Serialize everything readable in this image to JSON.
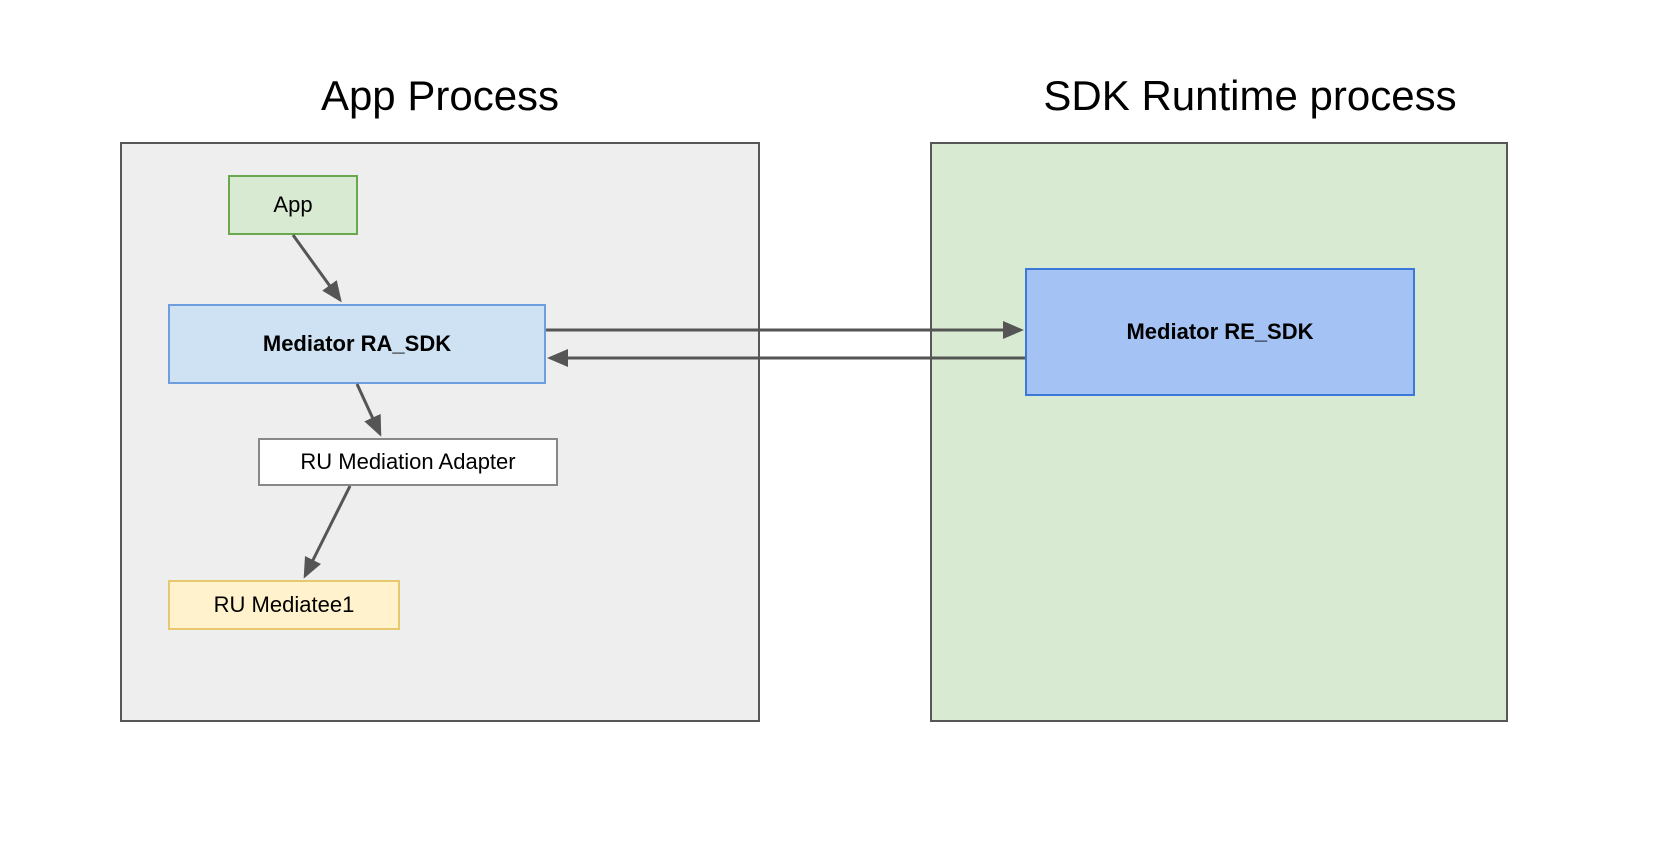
{
  "titles": {
    "app_process": "App Process",
    "sdk_runtime_process": "SDK Runtime process"
  },
  "nodes": {
    "app": "App",
    "mediator_ra_sdk": "Mediator RA_SDK",
    "ru_mediation_adapter": "RU Mediation Adapter",
    "ru_mediatee1": "RU Mediatee1",
    "mediator_re_sdk": "Mediator RE_SDK"
  },
  "colors": {
    "container_border": "#575757",
    "app_process_bg": "#eeeeee",
    "sdk_process_bg": "#d9ead3",
    "app_node_bg": "#d9ead3",
    "app_node_border": "#6aa84f",
    "ra_sdk_bg": "#cfe2f3",
    "ra_sdk_border": "#6e9de0",
    "adapter_bg": "#ffffff",
    "adapter_border": "#888888",
    "mediatee_bg": "#fff2cc",
    "mediatee_border": "#e6c96e",
    "re_sdk_bg": "#a4c2f4",
    "re_sdk_border": "#3c78d8",
    "arrow": "#555555"
  },
  "edges": [
    {
      "from": "app",
      "to": "mediator_ra_sdk",
      "direction": "down"
    },
    {
      "from": "mediator_ra_sdk",
      "to": "ru_mediation_adapter",
      "direction": "down"
    },
    {
      "from": "ru_mediation_adapter",
      "to": "ru_mediatee1",
      "direction": "down"
    },
    {
      "from": "mediator_ra_sdk",
      "to": "mediator_re_sdk",
      "direction": "bidirectional"
    }
  ]
}
